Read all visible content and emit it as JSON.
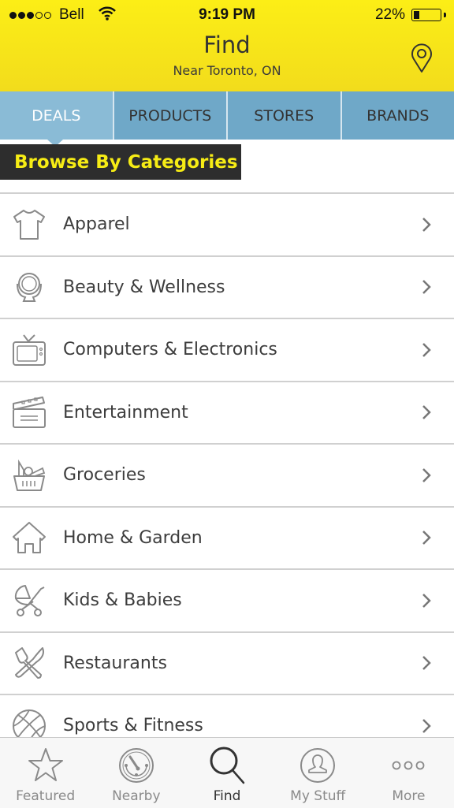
{
  "status_bar": {
    "signal_bars_filled": 3,
    "signal_bars_total": 5,
    "carrier": "Bell",
    "time": "9:19 PM",
    "battery_percent": "22%",
    "battery_level": 0.22
  },
  "header": {
    "title": "Find",
    "subtitle": "Near Toronto, ON",
    "location_icon": "map-pin-icon"
  },
  "tabs": [
    {
      "label": "DEALS",
      "active": true
    },
    {
      "label": "PRODUCTS",
      "active": false
    },
    {
      "label": "STORES",
      "active": false
    },
    {
      "label": "BRANDS",
      "active": false
    }
  ],
  "section_title": "Browse By Categories",
  "categories": [
    {
      "label": "Apparel",
      "icon": "tshirt-icon"
    },
    {
      "label": "Beauty & Wellness",
      "icon": "mirror-icon"
    },
    {
      "label": "Computers & Electronics",
      "icon": "tv-icon"
    },
    {
      "label": "Entertainment",
      "icon": "clapperboard-icon"
    },
    {
      "label": "Groceries",
      "icon": "basket-icon"
    },
    {
      "label": "Home & Garden",
      "icon": "house-icon"
    },
    {
      "label": "Kids & Babies",
      "icon": "stroller-icon"
    },
    {
      "label": "Restaurants",
      "icon": "utensils-icon"
    },
    {
      "label": "Sports & Fitness",
      "icon": "basketball-icon"
    }
  ],
  "tab_bar": [
    {
      "label": "Featured",
      "icon": "star-icon",
      "active": false
    },
    {
      "label": "Nearby",
      "icon": "radar-icon",
      "active": false
    },
    {
      "label": "Find",
      "icon": "search-icon",
      "active": true
    },
    {
      "label": "My Stuff",
      "icon": "user-icon",
      "active": false
    },
    {
      "label": "More",
      "icon": "more-dots-icon",
      "active": false
    }
  ],
  "colors": {
    "header_yellow": "#f7e51a",
    "tab_blue": "#6fa8c8",
    "tab_active_blue": "#8abbd6",
    "banner_bg": "#2d2d2d",
    "banner_text": "#f6ec15"
  }
}
